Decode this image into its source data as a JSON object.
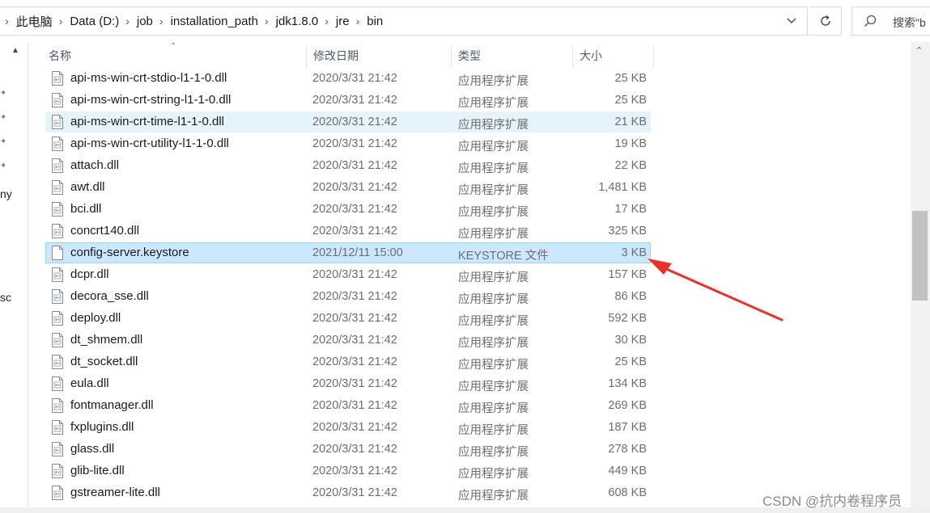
{
  "breadcrumb": [
    "此电脑",
    "Data (D:)",
    "job",
    "installation_path",
    "jdk1.8.0",
    "jre",
    "bin"
  ],
  "search": {
    "text": "搜索\"b"
  },
  "nav_fragments": [
    "ny",
    "sc"
  ],
  "columns": {
    "name": "名称",
    "date": "修改日期",
    "type": "类型",
    "size": "大小"
  },
  "files": [
    {
      "name": "api-ms-win-crt-stdio-l1-1-0.dll",
      "date": "2020/3/31 21:42",
      "type": "应用程序扩展",
      "size": "25 KB"
    },
    {
      "name": "api-ms-win-crt-string-l1-1-0.dll",
      "date": "2020/3/31 21:42",
      "type": "应用程序扩展",
      "size": "25 KB"
    },
    {
      "name": "api-ms-win-crt-time-l1-1-0.dll",
      "date": "2020/3/31 21:42",
      "type": "应用程序扩展",
      "size": "21 KB",
      "state": "hover"
    },
    {
      "name": "api-ms-win-crt-utility-l1-1-0.dll",
      "date": "2020/3/31 21:42",
      "type": "应用程序扩展",
      "size": "19 KB"
    },
    {
      "name": "attach.dll",
      "date": "2020/3/31 21:42",
      "type": "应用程序扩展",
      "size": "22 KB"
    },
    {
      "name": "awt.dll",
      "date": "2020/3/31 21:42",
      "type": "应用程序扩展",
      "size": "1,481 KB"
    },
    {
      "name": "bci.dll",
      "date": "2020/3/31 21:42",
      "type": "应用程序扩展",
      "size": "17 KB"
    },
    {
      "name": "concrt140.dll",
      "date": "2020/3/31 21:42",
      "type": "应用程序扩展",
      "size": "325 KB"
    },
    {
      "name": "config-server.keystore",
      "date": "2021/12/11 15:00",
      "type": "KEYSTORE 文件",
      "size": "3 KB",
      "state": "selected",
      "icon": "blank-file"
    },
    {
      "name": "dcpr.dll",
      "date": "2020/3/31 21:42",
      "type": "应用程序扩展",
      "size": "157 KB"
    },
    {
      "name": "decora_sse.dll",
      "date": "2020/3/31 21:42",
      "type": "应用程序扩展",
      "size": "86 KB"
    },
    {
      "name": "deploy.dll",
      "date": "2020/3/31 21:42",
      "type": "应用程序扩展",
      "size": "592 KB"
    },
    {
      "name": "dt_shmem.dll",
      "date": "2020/3/31 21:42",
      "type": "应用程序扩展",
      "size": "30 KB"
    },
    {
      "name": "dt_socket.dll",
      "date": "2020/3/31 21:42",
      "type": "应用程序扩展",
      "size": "25 KB"
    },
    {
      "name": "eula.dll",
      "date": "2020/3/31 21:42",
      "type": "应用程序扩展",
      "size": "134 KB"
    },
    {
      "name": "fontmanager.dll",
      "date": "2020/3/31 21:42",
      "type": "应用程序扩展",
      "size": "269 KB"
    },
    {
      "name": "fxplugins.dll",
      "date": "2020/3/31 21:42",
      "type": "应用程序扩展",
      "size": "187 KB"
    },
    {
      "name": "glass.dll",
      "date": "2020/3/31 21:42",
      "type": "应用程序扩展",
      "size": "278 KB"
    },
    {
      "name": "glib-lite.dll",
      "date": "2020/3/31 21:42",
      "type": "应用程序扩展",
      "size": "449 KB"
    },
    {
      "name": "gstreamer-lite.dll",
      "date": "2020/3/31 21:42",
      "type": "应用程序扩展",
      "size": "608 KB"
    }
  ],
  "colors": {
    "hover": "#e5f3fb",
    "selected": "#cce8ff",
    "selected_border": "#99d1ff",
    "arrow": "#e8322d"
  },
  "watermark": "CSDN @抗内卷程序员"
}
